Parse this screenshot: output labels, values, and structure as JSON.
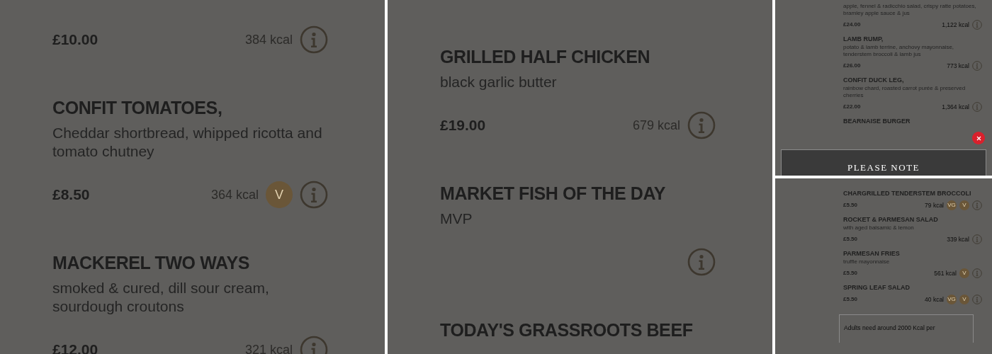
{
  "panels": [
    {
      "kind": "large",
      "items": [
        {
          "price": "£10.00",
          "kcal": "384 kcal",
          "info": true
        },
        {
          "name": "CONFIT TOMATOES,",
          "description": "Cheddar shortbread, whipped ricotta and tomato chutney",
          "price": "£8.50",
          "kcal": "364 kcal",
          "badges": [
            {
              "label": "V"
            }
          ],
          "info": true
        },
        {
          "name": "MACKEREL TWO WAYS",
          "description": "smoked & cured, dill sour cream, sourdough croutons",
          "price": "£12.00",
          "kcal": "321 kcal",
          "info": true
        }
      ]
    },
    {
      "kind": "large",
      "items": [
        {
          "name": "GRILLED HALF CHICKEN",
          "description": "black garlic butter",
          "price": "£19.00",
          "kcal": "679 kcal",
          "info": true
        },
        {
          "name": "MARKET FISH OF THE DAY",
          "description": "MVP",
          "info": true
        },
        {
          "name": "TODAY'S GRASSROOTS BEEF"
        }
      ]
    },
    {
      "kind": "small",
      "items": [
        {
          "description": "apple, fennel & radicchio salad, crispy ratte potatoes, bramley apple sauce & jus",
          "price": "£24.00",
          "kcal": "1,122 kcal",
          "info": true
        },
        {
          "name": "LAMB RUMP,",
          "description": "potato & lamb terrine, anchovy mayonnaise, tenderstem broccoli & lamb jus",
          "price": "£26.00",
          "kcal": "773 kcal",
          "info": true
        },
        {
          "name": "CONFIT DUCK LEG,",
          "description": "rainbow chard, roasted carrot purée & preserved cherries",
          "price": "£22.00",
          "kcal": "1,364 kcal",
          "info": true
        },
        {
          "name": "BEARNAISE BURGER"
        }
      ],
      "notice": {
        "title": "PLEASE NOTE"
      }
    },
    {
      "kind": "small",
      "items": [
        {
          "name": "CHARGRILLED TENDERSTEM BROCCOLI",
          "price": "£5.50",
          "kcal": "79 kcal",
          "badges": [
            {
              "label": "VG"
            },
            {
              "label": "V"
            }
          ],
          "info": true
        },
        {
          "name": "ROCKET & PARMESAN SALAD",
          "description": "with aged balsamic & lemon",
          "price": "£5.50",
          "kcal": "339 kcal",
          "info": true
        },
        {
          "name": "PARMESAN FRIES",
          "description": "truffle mayonnaise",
          "price": "£5.50",
          "kcal": "561 kcal",
          "badges": [
            {
              "label": "V"
            }
          ],
          "info": true
        },
        {
          "name": "SPRING LEAF SALAD",
          "price": "£5.50",
          "kcal": "40 kcal",
          "badges": [
            {
              "label": "VG"
            },
            {
              "label": "V"
            }
          ],
          "info": true
        }
      ],
      "footer": "Adults need around 2000 Kcal per"
    }
  ]
}
